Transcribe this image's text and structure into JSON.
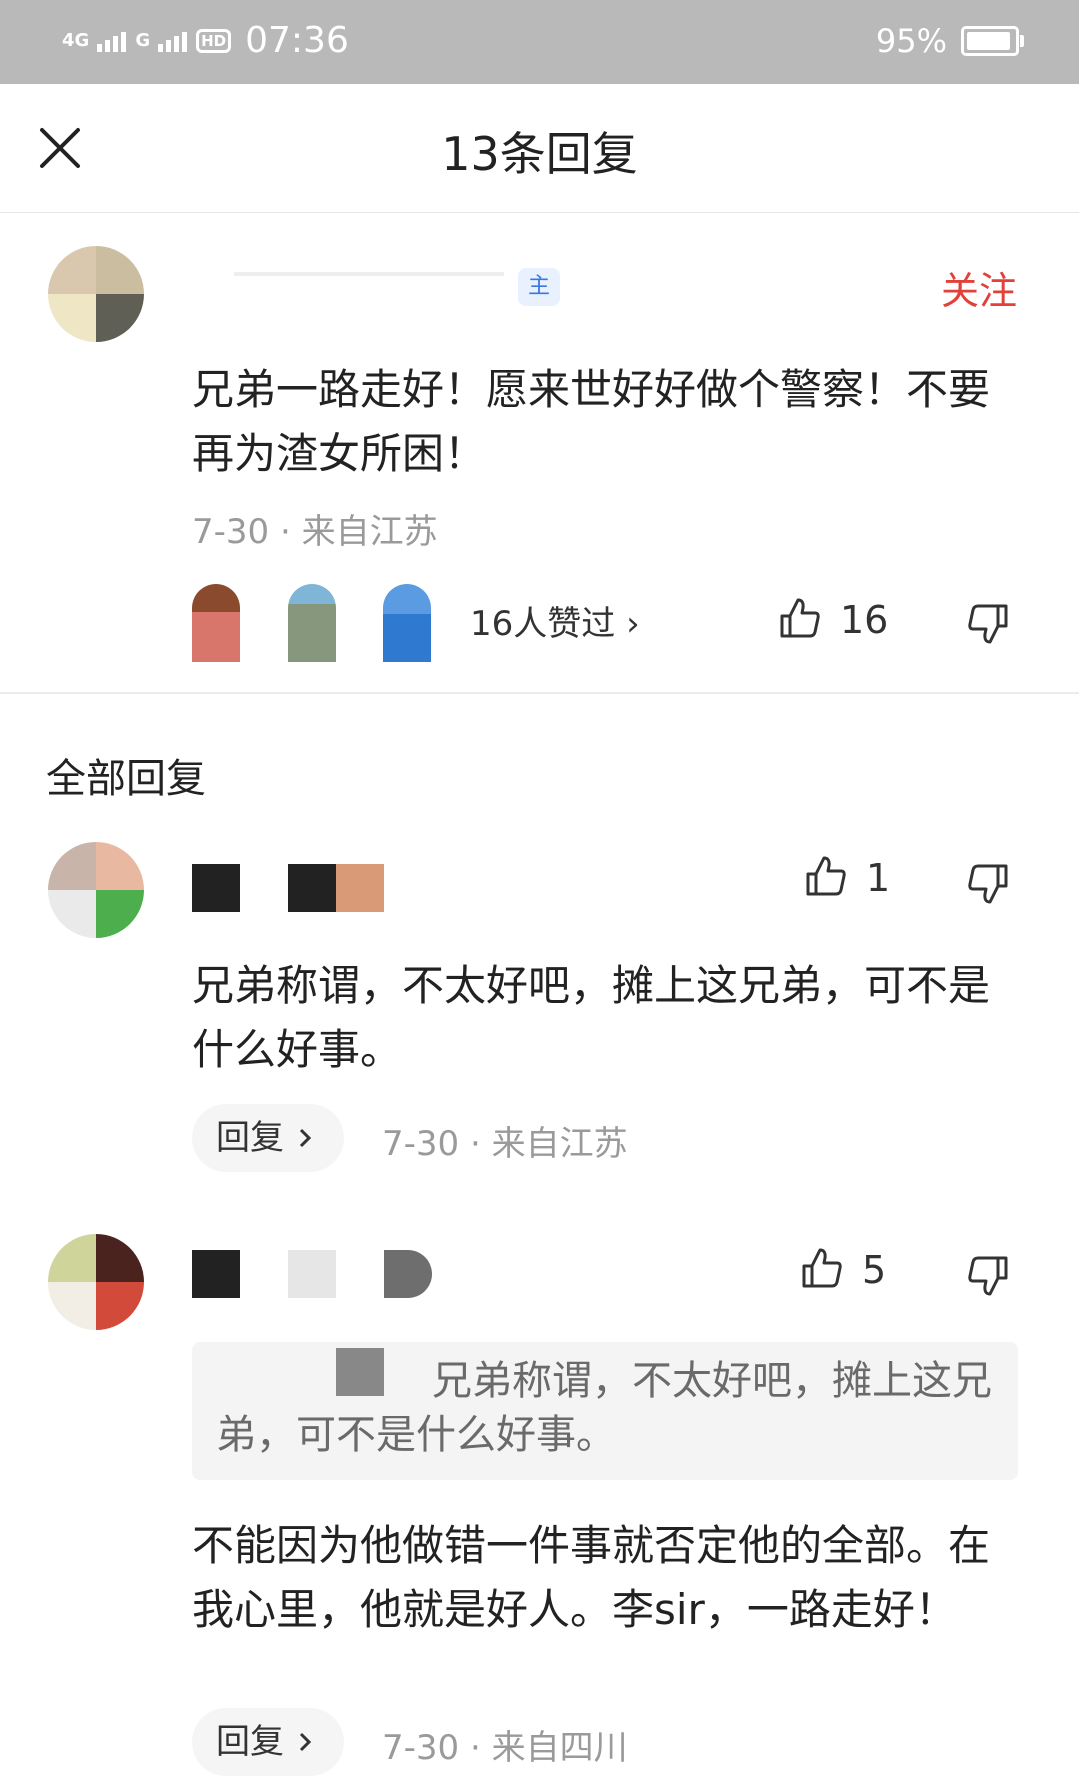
{
  "status_bar": {
    "network_1": "4G",
    "network_2": "G",
    "hd": "HD",
    "time": "07:36",
    "battery": "95%",
    "battery_level": 0.95
  },
  "header": {
    "title": "13条回复",
    "close_icon": "close-icon"
  },
  "main_comment": {
    "owner_tag": "主",
    "follow_label": "关注",
    "text": "兄弟一路走好！愿来世好好做个警察！不要再为渣女所困！",
    "meta": "7-30 · 来自江苏",
    "likers_text": "16人赞过 ›",
    "like_count": "16"
  },
  "section_title": "全部回复",
  "replies": [
    {
      "like_count": "1",
      "text": "兄弟称谓，不太好吧，摊上这兄弟，可不是什么好事。",
      "reply_label": "回复",
      "meta": "7-30 · 来自江苏"
    },
    {
      "like_count": "5",
      "quote": "兄弟称谓，不太好吧，摊上这兄弟，可不是什么好事。",
      "text": "不能因为他做错一件事就否定他的全部。在我心里，他就是好人。李sir，一路走好！",
      "reply_label": "回复",
      "meta": "7-30 · 来自四川"
    }
  ],
  "colors": {
    "accent_red": "#e2413a",
    "status_bar_bg": "#b9b9b9"
  }
}
